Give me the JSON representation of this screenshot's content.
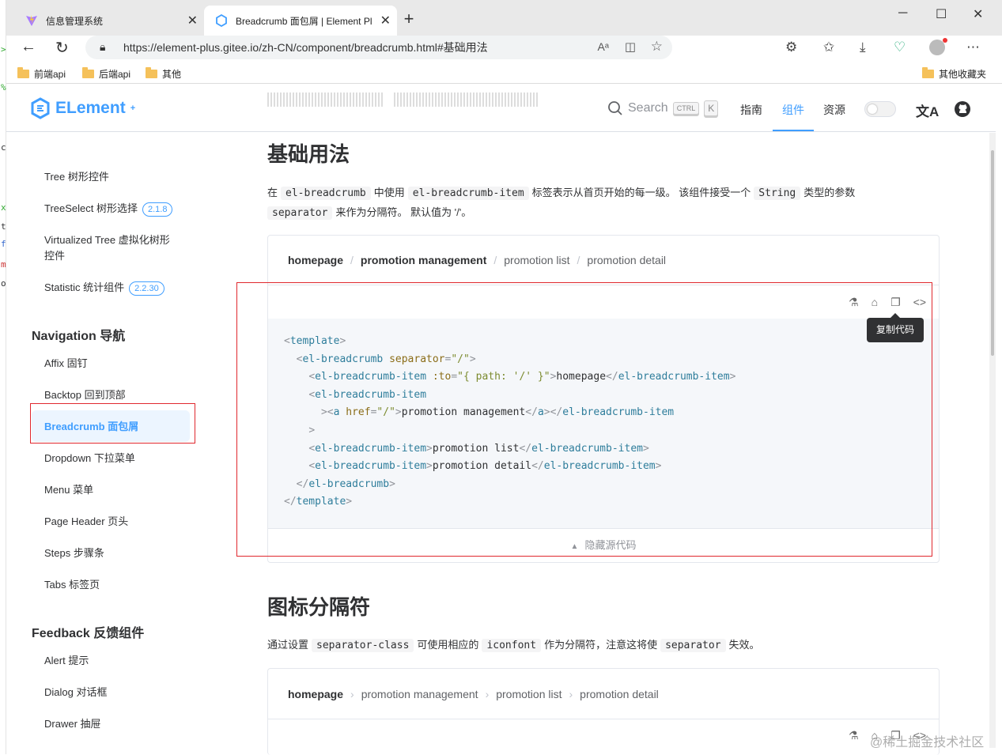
{
  "browser": {
    "tab1_title": "信息管理系统",
    "tab2_title": "Breadcrumb 面包屑 | Element Pl",
    "close": "✕",
    "newtab": "+",
    "url": "https://element-plus.gitee.io/zh-CN/component/breadcrumb.html#基础用法",
    "bookmarks": [
      "前端api",
      "后端api",
      "其他"
    ],
    "bookmark_other": "其他收藏夹"
  },
  "header": {
    "logo": "ELement",
    "search_label": "Search",
    "kbd1": "CTRL",
    "kbd2": "K",
    "nav": [
      "指南",
      "组件",
      "资源"
    ],
    "translate_icon": "文A"
  },
  "sidebar": {
    "items_top": [
      {
        "label": "Tree 树形控件"
      },
      {
        "label": "TreeSelect 树形选择",
        "badge": "2.1.8"
      },
      {
        "label": "Virtualized Tree 虚拟化树形控件"
      },
      {
        "label": "Statistic 统计组件",
        "badge": "2.2.30"
      }
    ],
    "group_nav": "Navigation 导航",
    "items_nav": [
      "Affix 固钉",
      "Backtop 回到顶部",
      "Breadcrumb 面包屑",
      "Dropdown 下拉菜单",
      "Menu 菜单",
      "Page Header 页头",
      "Steps 步骤条",
      "Tabs 标签页"
    ],
    "group_feedback": "Feedback 反馈组件",
    "items_feedback": [
      "Alert 提示",
      "Dialog 对话框",
      "Drawer 抽屉"
    ]
  },
  "main": {
    "section1_title": "基础用法",
    "s1_p1": "在",
    "s1_c1": "el-breadcrumb",
    "s1_p2": "中使用",
    "s1_c2": "el-breadcrumb-item",
    "s1_p3": "标签表示从首页开始的每一级。 该组件接受一个",
    "s1_c3": "String",
    "s1_p4": "类型的参数",
    "s1_c4": "separator",
    "s1_p5": "来作为分隔符。 默认值为 '/'。",
    "demo1_bc": [
      "homepage",
      "promotion management",
      "promotion list",
      "promotion detail"
    ],
    "demo1_sep": "/",
    "tooltip": "复制代码",
    "hide_code": "隐藏源代码",
    "section2_title": "图标分隔符",
    "s2_p1": "通过设置",
    "s2_c1": "separator-class",
    "s2_p2": "可使用相应的",
    "s2_c2": "iconfont",
    "s2_p3": "作为分隔符，注意这将使",
    "s2_c3": "separator",
    "s2_p4": "失效。",
    "demo2_bc": [
      "homepage",
      "promotion management",
      "promotion list",
      "promotion detail"
    ],
    "demo2_sep": "›"
  },
  "code": {
    "l1": [
      "<",
      "template",
      ">"
    ],
    "l2a": "el-breadcrumb",
    "l2b": "separator",
    "l2c": "\"/\"",
    "l3a": "el-breadcrumb-item",
    "l3b": ":to",
    "l3c": "\"{ path: '/' }\"",
    "l3d": "homepage",
    "l4a": "el-breadcrumb-item",
    "l5a": "a",
    "l5b": "href",
    "l5c": "\"/\"",
    "l5d": "promotion management",
    "l5e": "a",
    "l5f": "el-breadcrumb-item",
    "l7a": "el-breadcrumb-item",
    "l7d": "promotion list",
    "l8a": "el-breadcrumb-item",
    "l8d": "promotion detail",
    "l9a": "el-breadcrumb",
    "l10a": "template"
  },
  "watermark": "@稀土掘金技术社区",
  "colors": {
    "accent": "#409eff",
    "highlight_box": "#e0282e"
  }
}
